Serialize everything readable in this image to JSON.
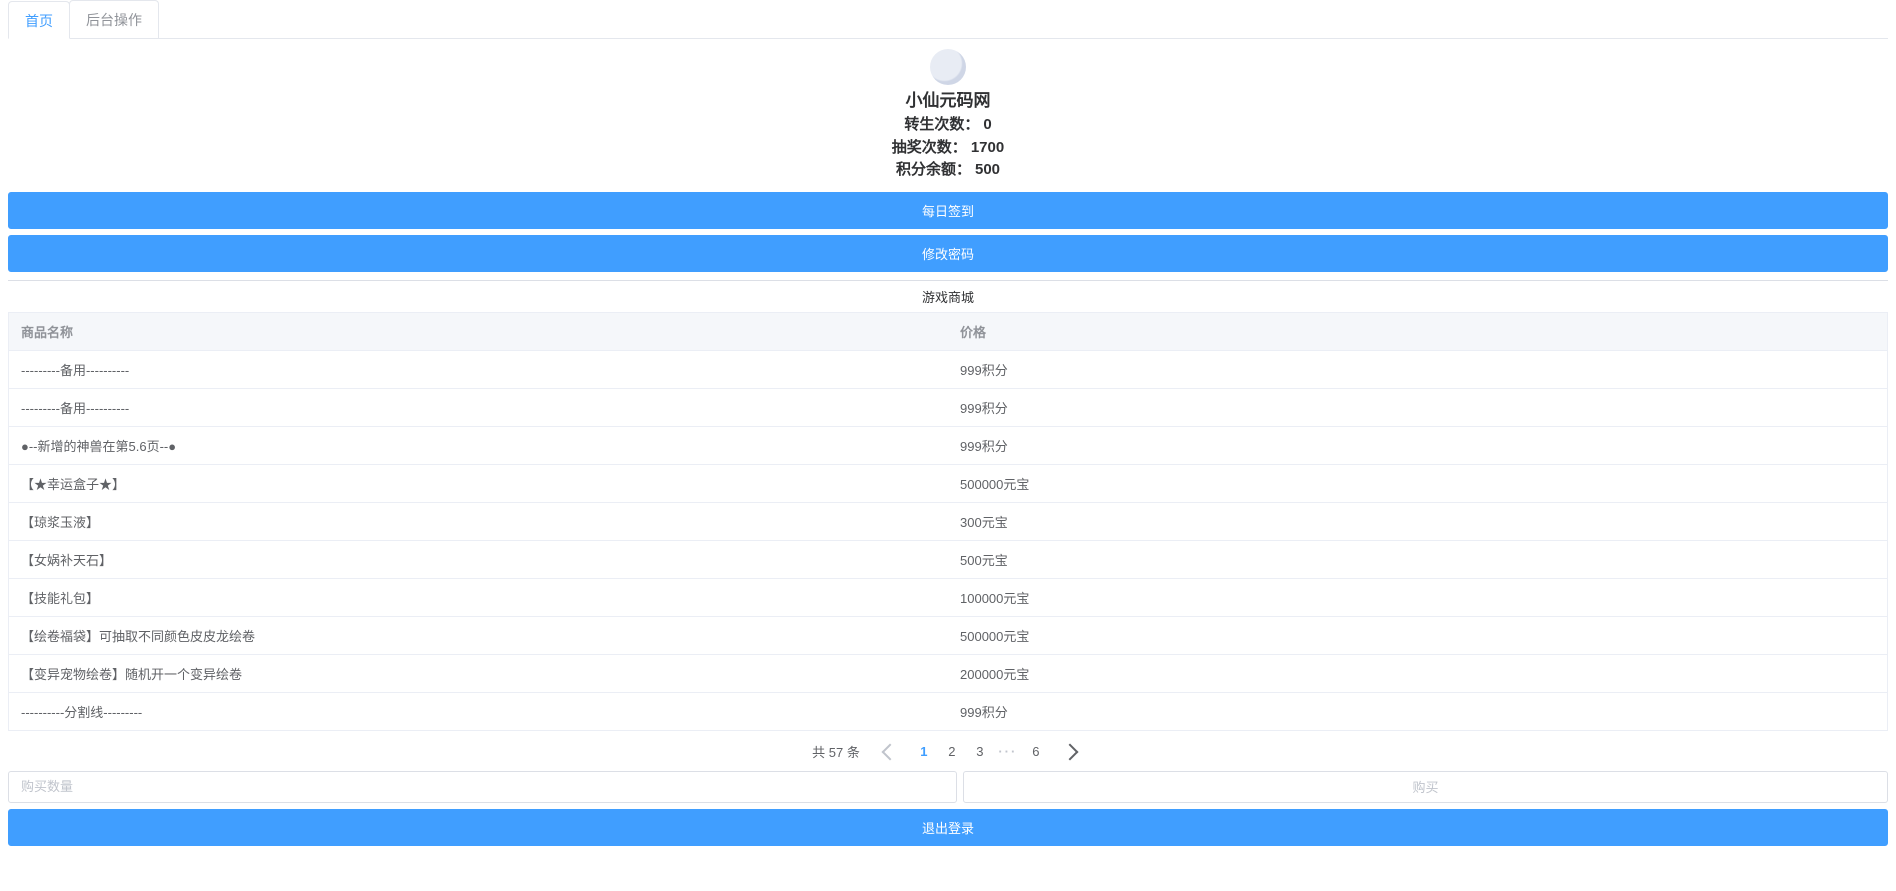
{
  "tabs": {
    "home": "首页",
    "backend": "后台操作"
  },
  "profile": {
    "site_name": "小仙元码网",
    "rebirth_label": "转生次数：",
    "rebirth_value": "0",
    "draw_label": "抽奖次数：",
    "draw_value": "1700",
    "points_label": "积分余额：",
    "points_value": "500"
  },
  "actions": {
    "daily_checkin": "每日签到",
    "change_password": "修改密码",
    "logout": "退出登录",
    "buy_label": "购买",
    "qty_placeholder": "购买数量"
  },
  "shop": {
    "title": "游戏商城",
    "header_name": "商品名称",
    "header_price": "价格",
    "items": [
      {
        "name": "---------备用----------",
        "price": "999积分"
      },
      {
        "name": "---------备用----------",
        "price": "999积分"
      },
      {
        "name": "●--新增的神兽在第5.6页--●",
        "price": "999积分"
      },
      {
        "name": "【★幸运盒子★】",
        "price": "500000元宝"
      },
      {
        "name": "【琼浆玉液】",
        "price": "300元宝"
      },
      {
        "name": "【女娲补天石】",
        "price": "500元宝"
      },
      {
        "name": "【技能礼包】",
        "price": "100000元宝"
      },
      {
        "name": "【绘卷福袋】可抽取不同颜色皮皮龙绘卷",
        "price": "500000元宝"
      },
      {
        "name": "【变异宠物绘卷】随机开一个变异绘卷",
        "price": "200000元宝"
      },
      {
        "name": "----------分割线---------",
        "price": "999积分"
      }
    ]
  },
  "pagination": {
    "total_text": "共 57 条",
    "pages": [
      "1",
      "2",
      "3",
      "6"
    ],
    "current": "1"
  }
}
